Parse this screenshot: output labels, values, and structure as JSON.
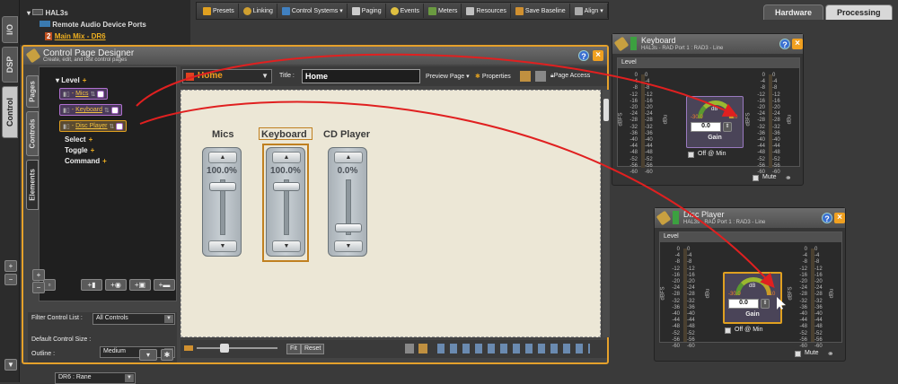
{
  "left_tabs": [
    "I/O",
    "DSP",
    "Control"
  ],
  "tree": {
    "device": "HAL3s",
    "ports": "Remote Audio Device Ports",
    "child_index": "2",
    "child_label": "Main Mix - DR6"
  },
  "toolbar": [
    "Presets",
    "Linking",
    "Control Systems",
    "Paging",
    "Events",
    "Meters",
    "Resources",
    "Save Baseline",
    "Align"
  ],
  "top_tabs": [
    "Hardware",
    "Processing"
  ],
  "cpd": {
    "title": "Control Page Designer",
    "subtitle": "Create, edit, and test control pages",
    "side_tabs": [
      "Pages",
      "Controls",
      "Elements"
    ],
    "tree_items": {
      "level": "Level",
      "select": "Select",
      "toggle": "Toggle",
      "command": "Command"
    },
    "plus": "+",
    "level_controls": [
      "Mics",
      "Keyboard",
      "Disc Player"
    ],
    "filter_label": "Filter Control List :",
    "filter_value": "All Controls",
    "size_label": "Default Control Size :",
    "size_value": "Medium",
    "outline_label": "Outline :",
    "outline_value": "DR6 : Rane",
    "page_select": "Home",
    "title_label": "Title :",
    "title_value": "Home",
    "preview": "Preview Page",
    "properties": "Properties",
    "page_access": "Page Access",
    "fit": "Fit",
    "reset": "Reset"
  },
  "faders": [
    {
      "label": "Mics",
      "value": "100.0%",
      "level": 1.0
    },
    {
      "label": "Keyboard",
      "value": "100.0%",
      "level": 1.0
    },
    {
      "label": "CD Player",
      "value": "0.0%",
      "level": 0.0
    }
  ],
  "remote_windows": [
    {
      "title": "Keyboard",
      "subtitle": "HAL3s - RAD Port 1 : RAD3 - Line",
      "section": "Level",
      "db_unit": "dB",
      "arc_min": "-30.0",
      "arc_max": "0.0",
      "value": "0.0",
      "gain_label": "Gain",
      "off_at_min": "Off @ Min",
      "mute": "Mute"
    },
    {
      "title": "Disc Player",
      "subtitle": "HAL3s - RAD Port 1 : RAD3 - Line",
      "section": "Level",
      "db_unit": "dB",
      "arc_min": "-30.0",
      "arc_max": "0.0",
      "value": "0.0",
      "gain_label": "Gain",
      "off_at_min": "Off @ Min",
      "mute": "Mute"
    }
  ],
  "meter_scale": [
    "0",
    "-4",
    "-8",
    "-12",
    "-16",
    "-20",
    "-24",
    "-28",
    "-32",
    "-36",
    "-40",
    "-44",
    "-48",
    "-52",
    "-56",
    "-60"
  ],
  "meter_scale_right": [
    "0",
    "-4",
    "-8",
    "-12",
    "-16",
    "-20",
    "-24",
    "-28",
    "-32",
    "-36",
    "-40",
    "-44",
    "-48",
    "-52",
    "-56",
    "-60"
  ],
  "meter_unit_left": "dBFS",
  "meter_unit_right": "dBu",
  "colors": {
    "accent": "#e5a12b",
    "link_arrow": "#e02020",
    "canvas": "#ece7d6"
  }
}
